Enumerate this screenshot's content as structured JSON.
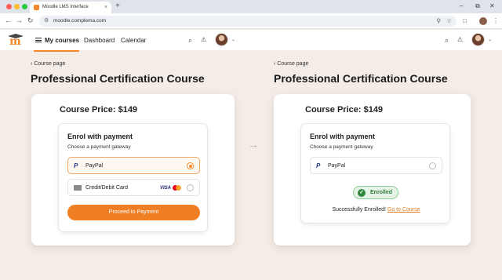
{
  "browser": {
    "tab_title": "Moodle LMS Interface",
    "new_tab": "+",
    "url": "moodle.complema.com",
    "minimize": "–",
    "restore": "⧉",
    "close": "✕",
    "tab_close": "×",
    "back": "←",
    "forward": "→",
    "reload": "↻",
    "menu": "⋮"
  },
  "nav": {
    "my_courses": "My courses",
    "dashboard": "Dashboard",
    "calendar": "Calendar",
    "search_icon": "⌕",
    "bell_icon": "🔔",
    "chevron": "⌄"
  },
  "left": {
    "back_link": "‹  Course page",
    "title": "Professional Certification Course",
    "price": "Course Price: $149",
    "enrol_title": "Enrol with payment",
    "choose": "Choose a payment gateway",
    "paypal": "PayPal",
    "card": "Credit/Debit Card",
    "visa": "VISA",
    "proceed": "Proceed to Payment"
  },
  "right": {
    "back_link": "‹  Course page",
    "title": "Professional Certification Course",
    "price": "Course Price: $149",
    "enrol_title": "Enrol with payment",
    "choose": "Choose a payment gateway",
    "paypal": "PayPal",
    "badge": "Enrolled",
    "success": "Successfully Enrolled!",
    "goto": "Go to Course"
  },
  "transition_arrow": "→",
  "colors": {
    "accent": "#f28a2b",
    "button": "#ef7f22",
    "success_green": "#2f8a3d",
    "page_bg": "#f4ece7"
  }
}
